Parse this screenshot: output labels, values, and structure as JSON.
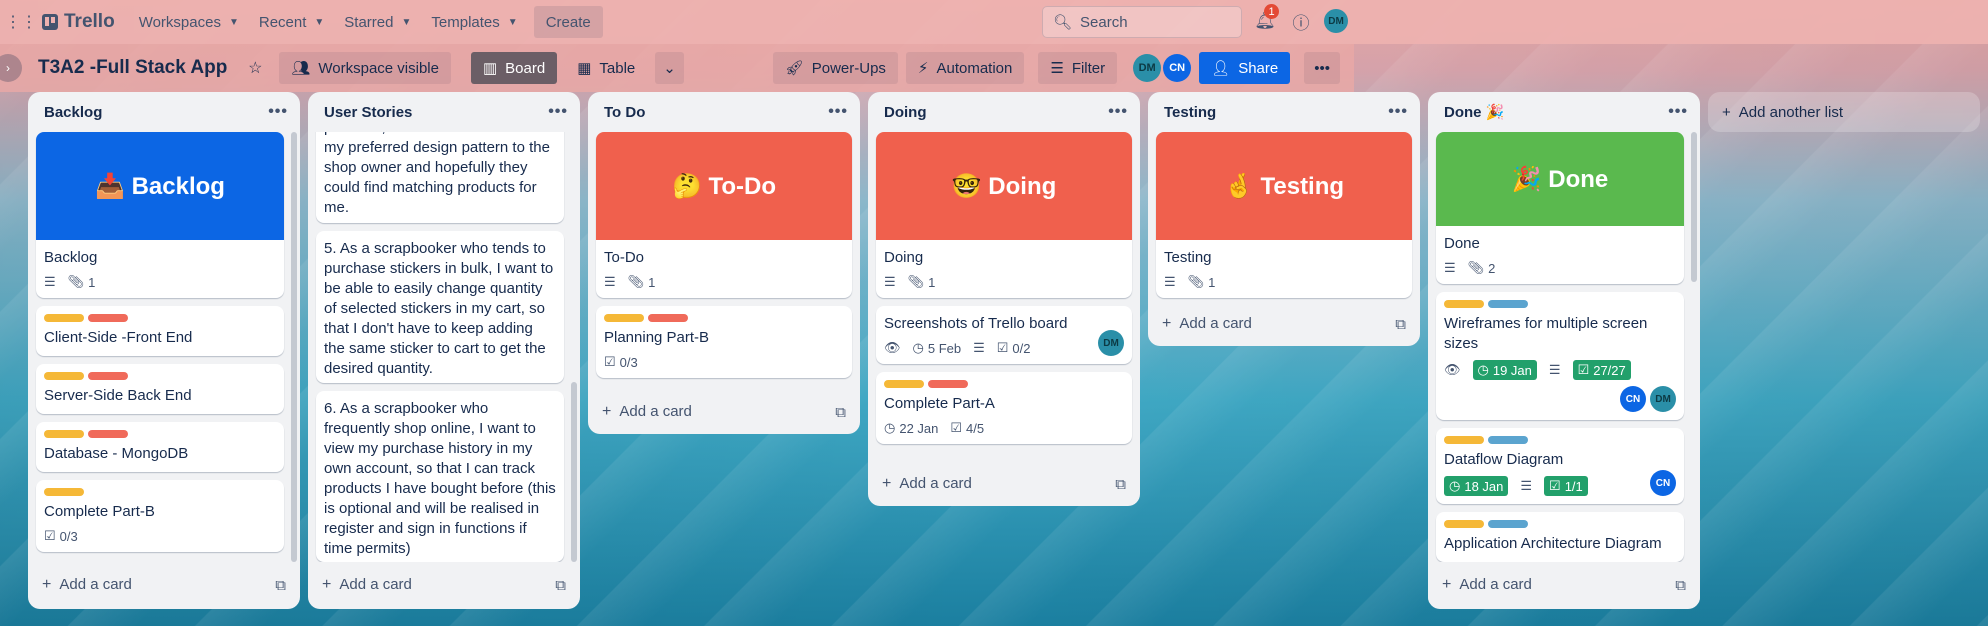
{
  "nav": {
    "workspaces": "Workspaces",
    "recent": "Recent",
    "starred": "Starred",
    "templates": "Templates",
    "create": "Create",
    "logo": "Trello",
    "search_placeholder": "Search",
    "notif_count": "1",
    "user_initials": "DM"
  },
  "board": {
    "title": "T3A2 -Full Stack App",
    "visibility": "Workspace visible",
    "view_board": "Board",
    "view_table": "Table",
    "powerups": "Power-Ups",
    "automation": "Automation",
    "filter": "Filter",
    "members": [
      "DM",
      "CN"
    ],
    "share": "Share"
  },
  "lists": [
    {
      "title": "Backlog",
      "cards": [
        {
          "cover_text": "📥 Backlog",
          "cover_color": "#0c66e4",
          "title": "Backlog",
          "attachments": "1"
        },
        {
          "labels": [
            "orange",
            "red"
          ],
          "title": "Client-Side -Front End"
        },
        {
          "labels": [
            "orange",
            "red"
          ],
          "title": "Server-Side Back End"
        },
        {
          "labels": [
            "orange",
            "red"
          ],
          "title": "Database - MongoDB"
        },
        {
          "labels": [
            "orange"
          ],
          "title": "Complete Part-B",
          "checklist": "0/3"
        }
      ],
      "add": "Add a card"
    },
    {
      "title": "User Stories",
      "cards": [
        {
          "text": "products, so that I can describe my preferred design pattern to the shop owner and hopefully they could find matching products for me."
        },
        {
          "text": "5. As a scrapbooker who tends to purchase stickers in bulk, I want to be able to easily change quantity of selected stickers in my cart, so that I don't have to keep adding the same sticker to cart to get the desired quantity."
        },
        {
          "text": "6. As a scrapbooker who frequently shop online, I want to view my purchase history in my own account, so that I can track products I have bought before (this is optional and will be realised in register and sign in functions if time permits)"
        }
      ],
      "add": "Add a card"
    },
    {
      "title": "To Do",
      "cards": [
        {
          "cover_text": "🤔 To-Do",
          "cover_color": "#f0604d",
          "title": "To-Do",
          "attachments": "1"
        },
        {
          "labels": [
            "orange",
            "red"
          ],
          "title": "Planning Part-B",
          "checklist": "0/3"
        }
      ],
      "add": "Add a card"
    },
    {
      "title": "Doing",
      "cards": [
        {
          "cover_text": "🤓 Doing",
          "cover_color": "#f0604d",
          "title": "Doing",
          "attachments": "1"
        },
        {
          "title": "Screenshots of Trello board",
          "date": "5 Feb",
          "checklist": "0/2",
          "member": "DM"
        },
        {
          "labels": [
            "orange",
            "red"
          ],
          "title": "Complete Part-A",
          "date": "22 Jan",
          "checklist": "4/5"
        }
      ],
      "add": "Add a card"
    },
    {
      "title": "Testing",
      "cards": [
        {
          "cover_text": "🤞 Testing",
          "cover_color": "#f0604d",
          "title": "Testing",
          "attachments": "1"
        }
      ],
      "add": "Add a card"
    },
    {
      "title": "Done 🎉",
      "cards": [
        {
          "cover_text": "🎉 Done",
          "cover_color": "#5ab94e",
          "title": "Done",
          "attachments": "2"
        },
        {
          "labels": [
            "orange",
            "blue"
          ],
          "title": "Wireframes for multiple screen sizes",
          "date": "19 Jan",
          "checklist": "27/27",
          "members": [
            "CN",
            "DM"
          ]
        },
        {
          "labels": [
            "orange",
            "blue"
          ],
          "title": "Dataflow Diagram",
          "date": "18 Jan",
          "checklist": "1/1",
          "members": [
            "CN"
          ]
        },
        {
          "labels": [
            "orange",
            "blue"
          ],
          "title": "Application Architecture Diagram"
        }
      ],
      "add": "Add a card"
    }
  ],
  "add_list": "Add another list"
}
